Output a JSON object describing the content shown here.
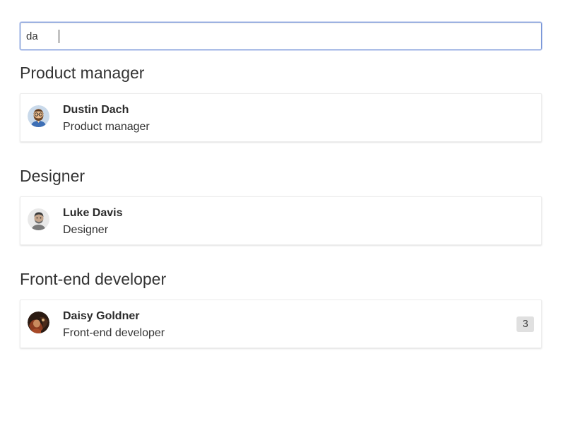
{
  "search": {
    "value": "da",
    "placeholder": ""
  },
  "groups": [
    {
      "title": "Product manager",
      "person": {
        "name": "Dustin Dach",
        "role": "Product manager",
        "avatar_icon": "bearded-man-glasses-avatar"
      }
    },
    {
      "title": "Designer",
      "person": {
        "name": "Luke Davis",
        "role": "Designer",
        "avatar_icon": "man-photo-avatar"
      }
    },
    {
      "title": "Front-end developer",
      "person": {
        "name": "Daisy Goldner",
        "role": "Front-end developer",
        "avatar_icon": "woman-photo-avatar",
        "badge": "3"
      }
    }
  ],
  "colors": {
    "focus_border": "#6f8fd6",
    "badge_bg": "#e0e0e0",
    "text": "#333333"
  }
}
